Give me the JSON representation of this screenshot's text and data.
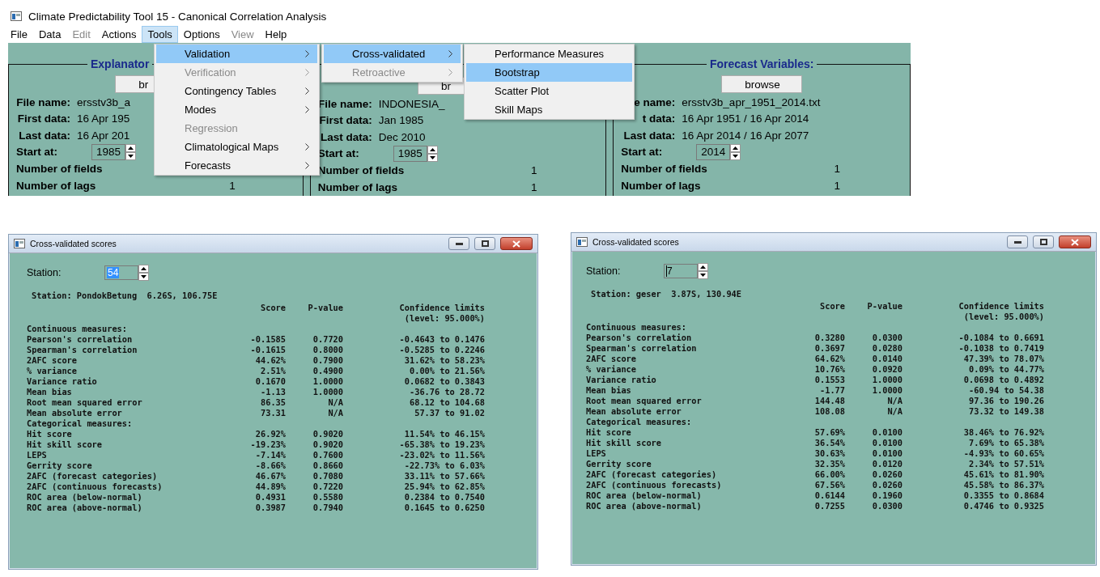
{
  "main_window": {
    "title": "Climate Predictability Tool 15 - Canonical Correlation Analysis",
    "menu_bar": [
      {
        "label": "File",
        "disabled": false,
        "selected": false
      },
      {
        "label": "Data",
        "disabled": false,
        "selected": false
      },
      {
        "label": "Edit",
        "disabled": true,
        "selected": false
      },
      {
        "label": "Actions",
        "disabled": false,
        "selected": false
      },
      {
        "label": "Tools",
        "disabled": false,
        "selected": true
      },
      {
        "label": "Options",
        "disabled": false,
        "selected": false
      },
      {
        "label": "View",
        "disabled": true,
        "selected": false
      },
      {
        "label": "Help",
        "disabled": false,
        "selected": false
      }
    ],
    "panels": [
      {
        "title": "Explanator",
        "browse": "br",
        "fields": [
          {
            "label": "File name:",
            "value": "ersstv3b_a"
          },
          {
            "label": "First data:",
            "value": "16 Apr 195"
          },
          {
            "label": "Last data:",
            "value": "16 Apr 201"
          }
        ],
        "start_label": "Start at:",
        "start_value": "1985",
        "counts": [
          {
            "label": "Number of fields"
          },
          {
            "label": "Number of lags",
            "value": "1"
          }
        ]
      },
      {
        "browse": "br",
        "fields": [
          {
            "label": "File name:",
            "value": "INDONESIA_"
          },
          {
            "label": "First data:",
            "value": "Jan 1985"
          },
          {
            "label": "Last data:",
            "value": "Dec 2010"
          }
        ],
        "start_label": "Start at:",
        "start_value": "1985",
        "counts": [
          {
            "label": "Number of fields",
            "value": "1"
          },
          {
            "label": "Number of lags",
            "value": "1"
          }
        ]
      },
      {
        "title": "Forecast Variables:",
        "browse": "browse",
        "fields": [
          {
            "label": "e name:",
            "value": "ersstv3b_apr_1951_2014.txt"
          },
          {
            "label": "t data:",
            "value": "16 Apr 1951 / 16 Apr 2014"
          },
          {
            "label": "Last data:",
            "value": "16 Apr 2014 / 16 Apr 2077"
          }
        ],
        "start_label": "Start at:",
        "start_value": "2014",
        "counts": [
          {
            "label": "Number of fields",
            "value": "1"
          },
          {
            "label": "Number of lags",
            "value": "1"
          }
        ]
      }
    ],
    "menus": [
      {
        "items": [
          {
            "label": "Validation",
            "disabled": false,
            "selected": true,
            "submenu": true
          },
          {
            "label": "Verification",
            "disabled": true,
            "selected": false,
            "submenu": true
          },
          {
            "label": "Contingency Tables",
            "disabled": false,
            "selected": false,
            "submenu": true
          },
          {
            "label": "Modes",
            "disabled": false,
            "selected": false,
            "submenu": true
          },
          {
            "label": "Regression",
            "disabled": true,
            "selected": false,
            "submenu": false
          },
          {
            "label": "Climatological Maps",
            "disabled": false,
            "selected": false,
            "submenu": true
          },
          {
            "label": "Forecasts",
            "disabled": false,
            "selected": false,
            "submenu": true
          }
        ]
      },
      {
        "items": [
          {
            "label": "Cross-validated",
            "disabled": false,
            "selected": true,
            "submenu": true
          },
          {
            "label": "Retroactive",
            "disabled": true,
            "selected": false,
            "submenu": true
          }
        ]
      },
      {
        "items": [
          {
            "label": "Performance Measures",
            "disabled": false,
            "selected": false,
            "submenu": false
          },
          {
            "label": "Bootstrap",
            "disabled": false,
            "selected": true,
            "submenu": false
          },
          {
            "label": "Scatter Plot",
            "disabled": false,
            "selected": false,
            "submenu": false
          },
          {
            "label": "Skill Maps",
            "disabled": false,
            "selected": false,
            "submenu": false
          }
        ]
      }
    ]
  },
  "score_windows": [
    {
      "title": "Cross-validated scores",
      "station_label": "Station:",
      "station_value": "54",
      "station_value_selected": true,
      "station_info": "Station: PondokBetung  6.26S, 106.75E",
      "columns": [
        "Score",
        "P-value",
        "Confidence limits"
      ],
      "level_note": "(level: 95.000%)",
      "rows": [
        {
          "kind": "heading",
          "label": "Continuous measures:"
        },
        {
          "kind": "measure",
          "label": "Pearson's correlation",
          "score": "-0.1585",
          "p_value": "0.7720",
          "ci": "-0.4643 to 0.1476"
        },
        {
          "kind": "measure",
          "label": "Spearman's correlation",
          "score": "-0.1615",
          "p_value": "0.8000",
          "ci": "-0.5285 to 0.2246"
        },
        {
          "kind": "measure",
          "label": "2AFC score",
          "score": "44.62%",
          "p_value": "0.7900",
          "ci": "31.62% to 58.23%"
        },
        {
          "kind": "measure",
          "label": "% variance",
          "score": "2.51%",
          "p_value": "0.4900",
          "ci": "0.00% to 21.56%"
        },
        {
          "kind": "measure",
          "label": "Variance ratio",
          "score": "0.1670",
          "p_value": "1.0000",
          "ci": "0.0682 to 0.3843"
        },
        {
          "kind": "measure",
          "label": "Mean bias",
          "score": "-1.13",
          "p_value": "1.0000",
          "ci": "-36.76 to 28.72"
        },
        {
          "kind": "measure",
          "label": "Root mean squared error",
          "score": "86.35",
          "p_value": "N/A",
          "ci": "68.12 to 104.68"
        },
        {
          "kind": "measure",
          "label": "Mean absolute error",
          "score": "73.31",
          "p_value": "N/A",
          "ci": "57.37 to 91.02"
        },
        {
          "kind": "heading",
          "label": "Categorical measures:"
        },
        {
          "kind": "measure",
          "label": "Hit score",
          "score": "26.92%",
          "p_value": "0.9020",
          "ci": "11.54% to 46.15%"
        },
        {
          "kind": "measure",
          "label": "Hit skill score",
          "score": "-19.23%",
          "p_value": "0.9020",
          "ci": "-65.38% to 19.23%"
        },
        {
          "kind": "measure",
          "label": "LEPS",
          "score": "-7.14%",
          "p_value": "0.7600",
          "ci": "-23.02% to 11.56%"
        },
        {
          "kind": "measure",
          "label": "Gerrity score",
          "score": "-8.66%",
          "p_value": "0.8660",
          "ci": "-22.73% to 6.03%"
        },
        {
          "kind": "measure",
          "label": "2AFC (forecast categories)",
          "score": "46.67%",
          "p_value": "0.7080",
          "ci": "33.11% to 57.66%"
        },
        {
          "kind": "measure",
          "label": "2AFC (continuous forecasts)",
          "score": "44.89%",
          "p_value": "0.7220",
          "ci": "25.94% to 62.85%"
        },
        {
          "kind": "measure",
          "label": "ROC area (below-normal)",
          "score": "0.4931",
          "p_value": "0.5580",
          "ci": "0.2384 to 0.7540"
        },
        {
          "kind": "measure",
          "label": "ROC area (above-normal)",
          "score": "0.3987",
          "p_value": "0.7940",
          "ci": "0.1645 to 0.6250"
        }
      ]
    },
    {
      "title": "Cross-validated scores",
      "station_label": "Station:",
      "station_value": "7",
      "station_value_selected": false,
      "station_info": "Station: geser  3.87S, 130.94E",
      "columns": [
        "Score",
        "P-value",
        "Confidence limits"
      ],
      "level_note": "(level: 95.000%)",
      "rows": [
        {
          "kind": "heading",
          "label": "Continuous measures:"
        },
        {
          "kind": "measure",
          "label": "Pearson's correlation",
          "score": "0.3280",
          "p_value": "0.0300",
          "ci": "-0.1084 to 0.6691"
        },
        {
          "kind": "measure",
          "label": "Spearman's correlation",
          "score": "0.3697",
          "p_value": "0.0280",
          "ci": "-0.1038 to 0.7419"
        },
        {
          "kind": "measure",
          "label": "2AFC score",
          "score": "64.62%",
          "p_value": "0.0140",
          "ci": "47.39% to 78.07%"
        },
        {
          "kind": "measure",
          "label": "% variance",
          "score": "10.76%",
          "p_value": "0.0920",
          "ci": "0.09% to 44.77%"
        },
        {
          "kind": "measure",
          "label": "Variance ratio",
          "score": "0.1553",
          "p_value": "1.0000",
          "ci": "0.0698 to 0.4892"
        },
        {
          "kind": "measure",
          "label": "Mean bias",
          "score": "-1.77",
          "p_value": "1.0000",
          "ci": "-60.94 to 54.38"
        },
        {
          "kind": "measure",
          "label": "Root mean squared error",
          "score": "144.48",
          "p_value": "N/A",
          "ci": "97.36 to 190.26"
        },
        {
          "kind": "measure",
          "label": "Mean absolute error",
          "score": "108.08",
          "p_value": "N/A",
          "ci": "73.32 to 149.38"
        },
        {
          "kind": "heading",
          "label": "Categorical measures:"
        },
        {
          "kind": "measure",
          "label": "Hit score",
          "score": "57.69%",
          "p_value": "0.0100",
          "ci": "38.46% to 76.92%"
        },
        {
          "kind": "measure",
          "label": "Hit skill score",
          "score": "36.54%",
          "p_value": "0.0100",
          "ci": "7.69% to 65.38%"
        },
        {
          "kind": "measure",
          "label": "LEPS",
          "score": "30.63%",
          "p_value": "0.0100",
          "ci": "-4.93% to 60.65%"
        },
        {
          "kind": "measure",
          "label": "Gerrity score",
          "score": "32.35%",
          "p_value": "0.0120",
          "ci": "2.34% to 57.51%"
        },
        {
          "kind": "measure",
          "label": "2AFC (forecast categories)",
          "score": "66.00%",
          "p_value": "0.0260",
          "ci": "45.61% to 81.90%"
        },
        {
          "kind": "measure",
          "label": "2AFC (continuous forecasts)",
          "score": "67.56%",
          "p_value": "0.0260",
          "ci": "45.58% to 86.37%"
        },
        {
          "kind": "measure",
          "label": "ROC area (below-normal)",
          "score": "0.6144",
          "p_value": "0.1960",
          "ci": "0.3355 to 0.8684"
        },
        {
          "kind": "measure",
          "label": "ROC area (above-normal)",
          "score": "0.7255",
          "p_value": "0.0300",
          "ci": "0.4746 to 0.9325"
        }
      ]
    }
  ]
}
